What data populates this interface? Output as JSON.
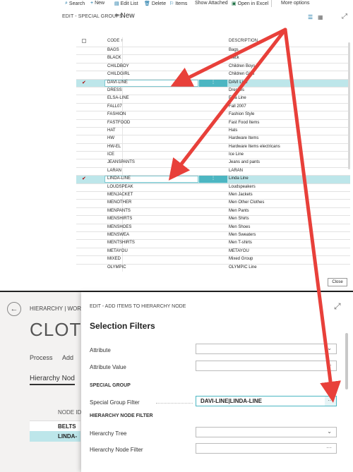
{
  "toolbar": {
    "items": [
      {
        "label": "Search",
        "icon": "search-icon"
      },
      {
        "label": "New",
        "icon": "plus-icon"
      },
      {
        "label": "Edit List",
        "icon": "edit-list-icon"
      },
      {
        "label": "Delete",
        "icon": "delete-icon"
      },
      {
        "label": "Items",
        "icon": "items-icon"
      },
      {
        "label": "Show Attached",
        "icon": ""
      },
      {
        "label": "Open in Excel",
        "icon": "excel-icon"
      },
      {
        "label": "More options",
        "icon": ""
      }
    ]
  },
  "list_page": {
    "title": "EDIT - SPECIAL GROUPS",
    "new_label": "+ New",
    "columns": {
      "code": "CODE ↑",
      "description": "DESCRIPTION"
    },
    "rows": [
      {
        "code": "BAGS",
        "desc": "Bags",
        "checked": false,
        "selected": false
      },
      {
        "code": "BLACK",
        "desc": "Black",
        "checked": false,
        "selected": false
      },
      {
        "code": "CHILDBOY",
        "desc": "Children Boys",
        "checked": false,
        "selected": false
      },
      {
        "code": "CHILDGIRL",
        "desc": "Children Girls",
        "checked": false,
        "selected": false
      },
      {
        "code": "DAVI-LINE",
        "desc": "DAVI Line",
        "checked": true,
        "selected": true
      },
      {
        "code": "DRESS",
        "desc": "Dresses",
        "checked": false,
        "selected": false
      },
      {
        "code": "ELSA-LINE",
        "desc": "Elsa Line",
        "checked": false,
        "selected": false
      },
      {
        "code": "FALL07",
        "desc": "Fall 2007",
        "checked": false,
        "selected": false
      },
      {
        "code": "FASHION",
        "desc": "Fashion Style",
        "checked": false,
        "selected": false
      },
      {
        "code": "FASTFOOD",
        "desc": "Fast Food Items",
        "checked": false,
        "selected": false
      },
      {
        "code": "HAT",
        "desc": "Hats",
        "checked": false,
        "selected": false
      },
      {
        "code": "HW",
        "desc": "Hardware Items",
        "checked": false,
        "selected": false
      },
      {
        "code": "HW-EL",
        "desc": "Hardware Items electricans",
        "checked": false,
        "selected": false
      },
      {
        "code": "ICE",
        "desc": "Ice Line",
        "checked": false,
        "selected": false
      },
      {
        "code": "JEANSPANTS",
        "desc": "Jeans and pants",
        "checked": false,
        "selected": false
      },
      {
        "code": "LARAN",
        "desc": "LARAN",
        "checked": false,
        "selected": false
      },
      {
        "code": "LINDA-LINE",
        "desc": "Linda Line",
        "checked": true,
        "selected": true
      },
      {
        "code": "LOUDSPEAK",
        "desc": "Loudspeakers",
        "checked": false,
        "selected": false
      },
      {
        "code": "MENJACKET",
        "desc": "Men Jackets",
        "checked": false,
        "selected": false
      },
      {
        "code": "MENOTHER",
        "desc": "Men Other Clothes",
        "checked": false,
        "selected": false
      },
      {
        "code": "MENPANTS",
        "desc": "Men Pants",
        "checked": false,
        "selected": false
      },
      {
        "code": "MENSHIRTS",
        "desc": "Men Shirts",
        "checked": false,
        "selected": false
      },
      {
        "code": "MENSHOES",
        "desc": "Men Shoes",
        "checked": false,
        "selected": false
      },
      {
        "code": "MENSWEA",
        "desc": "Men Sweaters",
        "checked": false,
        "selected": false
      },
      {
        "code": "MENTSHIRTS",
        "desc": "Men T-shirts",
        "checked": false,
        "selected": false
      },
      {
        "code": "METAYOU",
        "desc": "METAYOU",
        "checked": false,
        "selected": false
      },
      {
        "code": "MIXED",
        "desc": "Mixed Group",
        "checked": false,
        "selected": false
      },
      {
        "code": "OLYMPIC",
        "desc": "OLYMPIC Line",
        "checked": false,
        "selected": false
      }
    ],
    "close_label": "Close"
  },
  "background_page": {
    "breadcrumb": "HIERARCHY | WOR",
    "title": "CLOTH",
    "actions": [
      "Process",
      "Add"
    ],
    "section": "Hierarchy Nod",
    "column": "NODE ID",
    "rows": [
      "BELTS",
      "LINDA-"
    ]
  },
  "dialog": {
    "title": "EDIT - ADD ITEMS TO HIERARCHY NODE",
    "heading": "Selection Filters",
    "fields": {
      "attribute": {
        "label": "Attribute",
        "value": ""
      },
      "attribute_value": {
        "label": "Attribute Value",
        "value": ""
      },
      "special_group_section": "SPECIAL GROUP",
      "special_group_filter": {
        "label": "Special Group Filter",
        "value": "DAVI-LINE|LINDA-LINE"
      },
      "hierarchy_section": "HIERARCHY NODE FILTER",
      "hierarchy_tree": {
        "label": "Hierarchy Tree",
        "value": ""
      },
      "hierarchy_node_filter": {
        "label": "Hierarchy Node Filter",
        "value": ""
      }
    },
    "dots": "···",
    "chevron": "⌄"
  },
  "colors": {
    "accent": "#4cb6c2",
    "selected_row": "#bde6ea",
    "arrow": "#e8403a"
  }
}
